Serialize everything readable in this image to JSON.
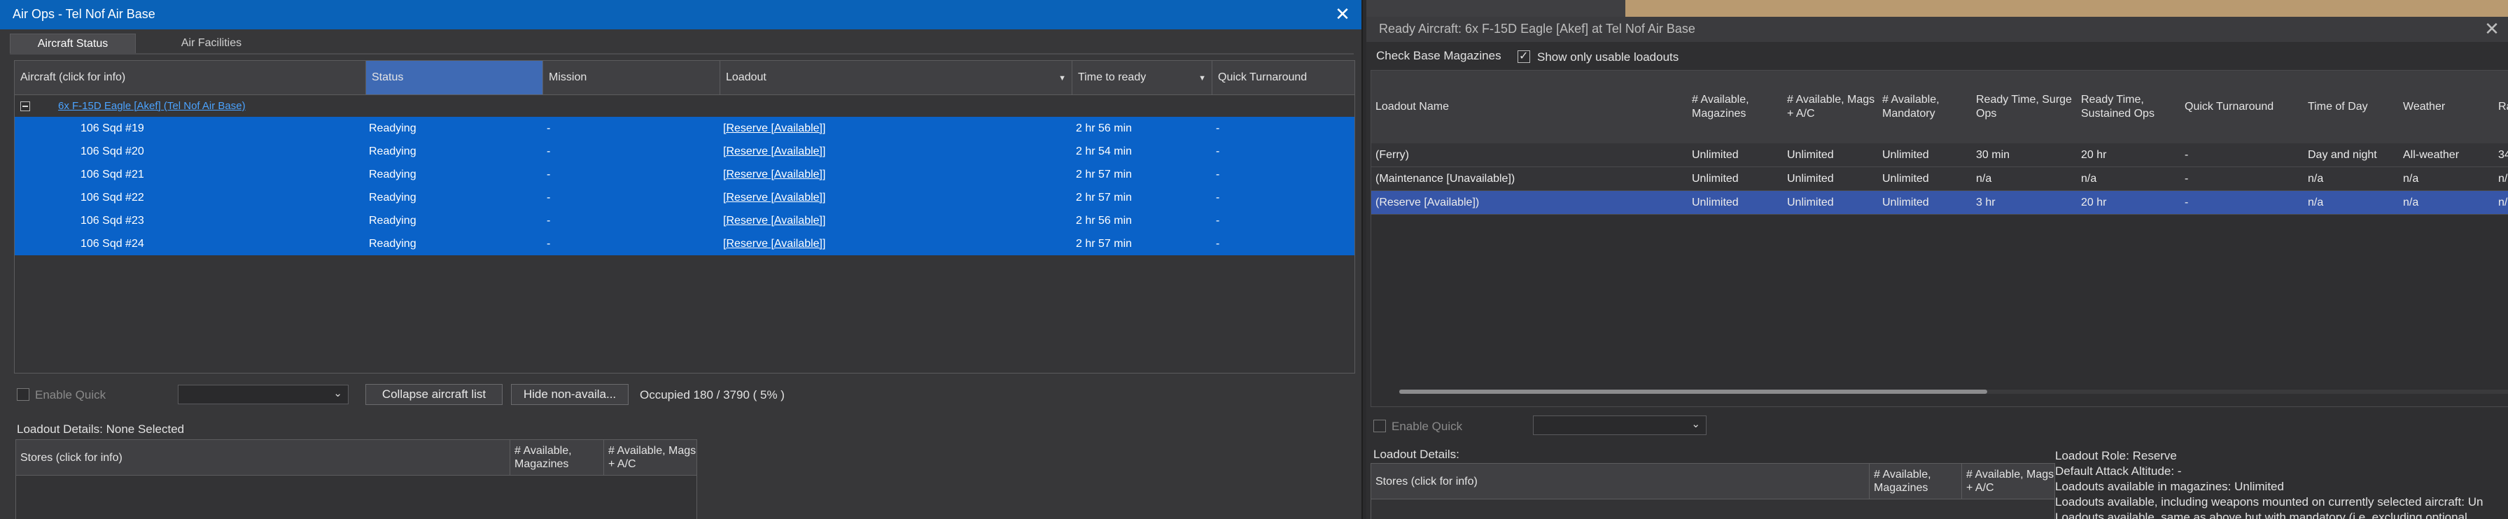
{
  "left": {
    "title": "Air Ops - Tel Nof Air Base",
    "close_glyph": "✕",
    "tabs": [
      {
        "label": "Aircraft Status"
      },
      {
        "label": "Air Facilities"
      }
    ],
    "columns": [
      {
        "label": "Aircraft (click for info)"
      },
      {
        "label": "Status"
      },
      {
        "label": "Mission"
      },
      {
        "label": "Loadout"
      },
      {
        "label": "Time to ready"
      },
      {
        "label": "Quick Turnaround"
      }
    ],
    "group_label": "6x F-15D Eagle [Akef] (Tel Nof Air Base)",
    "rows": [
      {
        "aircraft": "106 Sqd #19",
        "status": "Readying",
        "mission": "-",
        "loadout": "[Reserve [Available]]",
        "time": "2 hr 56 min",
        "quick": "-"
      },
      {
        "aircraft": "106 Sqd #20",
        "status": "Readying",
        "mission": "-",
        "loadout": "[Reserve [Available]]",
        "time": "2 hr 54 min",
        "quick": "-"
      },
      {
        "aircraft": "106 Sqd #21",
        "status": "Readying",
        "mission": "-",
        "loadout": "[Reserve [Available]]",
        "time": "2 hr 57 min",
        "quick": "-"
      },
      {
        "aircraft": "106 Sqd #22",
        "status": "Readying",
        "mission": "-",
        "loadout": "[Reserve [Available]]",
        "time": "2 hr 57 min",
        "quick": "-"
      },
      {
        "aircraft": "106 Sqd #23",
        "status": "Readying",
        "mission": "-",
        "loadout": "[Reserve [Available]]",
        "time": "2 hr 56 min",
        "quick": "-"
      },
      {
        "aircraft": "106 Sqd #24",
        "status": "Readying",
        "mission": "-",
        "loadout": "[Reserve [Available]]",
        "time": "2 hr 57 min",
        "quick": "-"
      }
    ],
    "enable_quick": "Enable Quick",
    "collapse_button": "Collapse aircraft list",
    "hide_button": "Hide non-availa...",
    "occupied": "Occupied 180 / 3790 ( 5% )",
    "loadout_details": "Loadout Details: None Selected",
    "stores_columns": [
      "Stores (click for info)",
      "# Available, Magazines",
      "# Available, Mags + A/C"
    ]
  },
  "right": {
    "title": "Ready Aircraft: 6x F-15D Eagle [Akef] at Tel Nof Air Base",
    "close_glyph": "✕",
    "check_base_magazines": "Check Base Magazines",
    "show_usable": "Show only usable loadouts",
    "columns": [
      {
        "label": "Loadout Name"
      },
      {
        "label": "# Available, Magazines"
      },
      {
        "label": "# Available, Mags + A/C"
      },
      {
        "label": "# Available, Mandatory"
      },
      {
        "label": "Ready Time, Surge Ops"
      },
      {
        "label": "Ready Time, Sustained Ops"
      },
      {
        "label": "Quick Turnaround"
      },
      {
        "label": "Time of Day"
      },
      {
        "label": "Weather"
      },
      {
        "label": "Ra"
      }
    ],
    "rows": [
      {
        "name": "(Ferry)",
        "mag": "Unlimited",
        "magsac": "Unlimited",
        "mand": "Unlimited",
        "surge": "30 min",
        "sust": "20 hr",
        "quick": "-",
        "tod": "Day and night",
        "weather": "All-weather",
        "ra": "34"
      },
      {
        "name": "(Maintenance [Unavailable])",
        "mag": "Unlimited",
        "magsac": "Unlimited",
        "mand": "Unlimited",
        "surge": "n/a",
        "sust": "n/a",
        "quick": "-",
        "tod": "n/a",
        "weather": "n/a",
        "ra": "n/"
      },
      {
        "name": "(Reserve [Available])",
        "mag": "Unlimited",
        "magsac": "Unlimited",
        "mand": "Unlimited",
        "surge": "3 hr",
        "sust": "20 hr",
        "quick": "-",
        "tod": "n/a",
        "weather": "n/a",
        "ra": "n/"
      }
    ],
    "enable_quick": "Enable Quick",
    "loadout_details": "Loadout Details:",
    "stores_columns": [
      "Stores (click for info)",
      "# Available, Magazines",
      "# Available, Mags + A/C"
    ],
    "details_lines": [
      "Loadout Role: Reserve",
      "Default Attack Altitude: -",
      "Loadouts available in magazines: Unlimited",
      "Loadouts available, including weapons mounted on currently selected aircraft: Un",
      "Loadouts available, same as above but with mandatory (i.e. excluding optional"
    ]
  }
}
